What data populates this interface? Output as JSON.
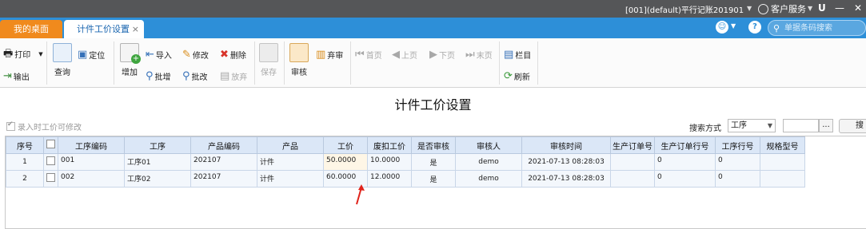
{
  "topbar": {
    "account": "[001](default)平行记账201901",
    "customer_service": "客户服务",
    "pin_icon": "U"
  },
  "tabs": {
    "home": "我的桌面",
    "current": "计件工价设置",
    "close": "×",
    "search_placeholder": "单据条码搜索"
  },
  "toolbar": {
    "print": "打印",
    "export": "输出",
    "query": "查询",
    "locate": "定位",
    "add": "增加",
    "import": "导入",
    "batch_add": "批增",
    "modify": "修改",
    "batch_modify": "批改",
    "delete": "删除",
    "abandon": "放弃",
    "save": "保存",
    "review": "审核",
    "unreview": "弃审",
    "first": "首页",
    "prev": "上页",
    "next": "下页",
    "last": "末页",
    "columns": "栏目",
    "refresh": "刷新"
  },
  "page": {
    "title": "计件工价设置",
    "editable_label": "录入时工价可修改",
    "search_mode_label": "搜索方式",
    "search_mode_value": "工序",
    "dots": "...",
    "search_button": "搜索"
  },
  "table": {
    "headers": [
      "序号",
      "",
      "工序编码",
      "工序",
      "产品编码",
      "产品",
      "工价",
      "废扣工价",
      "是否审核",
      "审核人",
      "审核时间",
      "生产订单号",
      "生产订单行号",
      "工序行号",
      "规格型号"
    ],
    "rows": [
      [
        "1",
        "",
        "001",
        "工序01",
        "202107",
        "计件",
        "50.0000",
        "10.0000",
        "是",
        "demo",
        "2021-07-13 08:28:03",
        "",
        "0",
        "0",
        ""
      ],
      [
        "2",
        "",
        "002",
        "工序02",
        "202107",
        "计件",
        "60.0000",
        "12.0000",
        "是",
        "demo",
        "2021-07-13 08:28:03",
        "",
        "0",
        "0",
        ""
      ]
    ]
  },
  "colors": {
    "topbar": "#555658",
    "tabbar": "#2d8fd8",
    "home_tab": "#f08a1d",
    "header": "#dbe7f7",
    "arrow": "#e0231b"
  }
}
